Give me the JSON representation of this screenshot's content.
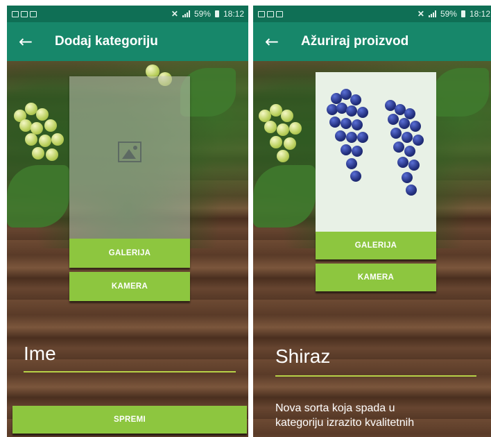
{
  "status_bar": {
    "battery": "59%",
    "time": "18:12"
  },
  "left_screen": {
    "title": "Dodaj kategoriju",
    "gallery_button": "GALERIJA",
    "camera_button": "KAMERA",
    "name_field_value": "Ime",
    "save_button": "SPREMI"
  },
  "right_screen": {
    "title": "Ažuriraj proizvod",
    "gallery_button": "GALERIJA",
    "camera_button": "KAMERA",
    "name_field_value": "Shiraz",
    "description_line1": "Nova sorta koja spada u",
    "description_line2": "kategoriju izrazito kvalitetnih"
  },
  "colors": {
    "status_bar": "#0f6f55",
    "app_bar": "#17876a",
    "accent_button": "#8dc63f",
    "field_underline": "#b7d247"
  }
}
